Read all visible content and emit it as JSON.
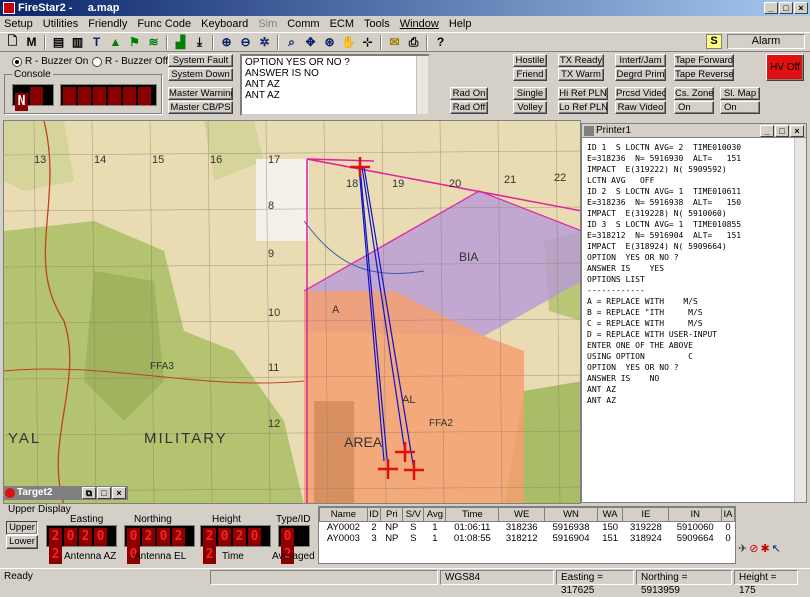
{
  "window": {
    "title": "FireStar2 -     a.map"
  },
  "menu": [
    "Setup",
    "Utilities",
    "Friendly",
    "Func Code",
    "Keyboard",
    "Sim",
    "Comm",
    "ECM",
    "Tools",
    "Window",
    "Help"
  ],
  "toolbar_icons": [
    "new-icon",
    "m-icon",
    "document-icon",
    "document-icon",
    "text-icon",
    "target-icon",
    "flag-icon",
    "grid-icon",
    "save-icon",
    "download-icon",
    "zoom-in-icon",
    "zoom-out-icon",
    "zoom-extents-icon",
    "search-icon",
    "pan-icon",
    "target-zoom-icon",
    "hand-icon",
    "pointer-icon",
    "comment-icon",
    "print-icon",
    "help-icon"
  ],
  "status_indicator": {
    "s_label": "S",
    "alarm": "Alarm"
  },
  "buzzer": {
    "on": "R - Buzzer On",
    "off": "R - Buzzer Off",
    "console": "Console"
  },
  "console_digits": "N",
  "system_buttons": [
    "System Fault",
    "System Down",
    "Master Warning",
    "Master CB/PS"
  ],
  "option_text": [
    "OPTION  YES OR NO ?",
    "ANSWER IS    NO",
    "ANT AZ",
    "ANT AZ"
  ],
  "ctrl_buttons": {
    "hostile": "Hostile",
    "friend": "Friend",
    "tx_ready": "TX Ready",
    "tx_warm": "TX Warm",
    "interf": "Interf/Jam",
    "degrd": "Degrd Prim",
    "tape_fwd": "Tape Forward",
    "tape_rev": "Tape Reverse",
    "hv_off": "HV Off",
    "rad_on": "Rad On",
    "rad_off": "Rad Off",
    "single": "Single",
    "volley": "Volley",
    "hi_ref": "Hi Ref PLN",
    "lo_ref": "Lo Ref PLN",
    "prcsd": "Prcsd Video",
    "raw": "Raw Video",
    "cs_zone": "Cs. Zone",
    "cs_on": "On",
    "sl_map": "Sl. Map",
    "sl_on": "On"
  },
  "map": {
    "labels": [
      "13",
      "14",
      "15",
      "16",
      "17",
      "18",
      "19",
      "20",
      "21",
      "22",
      "8",
      "9",
      "10",
      "11",
      "12",
      "FFA3",
      "MILITARY",
      "YAL",
      "BIA",
      "AREA",
      "FFA2",
      "AL",
      "A"
    ]
  },
  "printer": {
    "title": "Printer1",
    "lines": [
      "ID 1  S LOCTN AVG= 2  TIME010030",
      "E=318236  N= 5916930  ALT=   151",
      "IMPACT  E(319222) N( 5909592)",
      "LCTN AVG   OFF",
      "ID 2  S LOCTN AVG= 1  TIME010611",
      "E=318236  N= 5916938  ALT=   150",
      "IMPACT  E(319228) N( 5910060)",
      "ID 3  S LOCTN AVG= 1  TIME010855",
      "E=318212  N= 5916904  ALT=   151",
      "IMPACT  E(318924) N( 5909664)",
      "OPTION  YES OR NO ?",
      "ANSWER IS    YES",
      "OPTIONS LIST",
      "------------",
      "A = REPLACE WITH    M/S",
      "B = REPLACE \"ITH     M/S",
      "C = REPLACE WITH     M/S",
      "D = REPLACE WITH USER-INPUT",
      "ENTER ONE OF THE ABOVE",
      "USING OPTION         C",
      "OPTION  YES OR NO ?",
      "ANSWER IS    NO",
      "ANT AZ",
      "ANT AZ"
    ]
  },
  "target2": {
    "title": "Target2",
    "upper_display": "Upper Display",
    "upper": "Upper",
    "lower": "Lower",
    "easting_label": "Easting",
    "easting": "20202",
    "northing_label": "Northing",
    "northing": "02020",
    "height_label": "Height",
    "height": "20202",
    "type_label": "Type/ID",
    "type": "02",
    "antenna_az": "Antenna AZ",
    "antenna_el": "Antenna EL",
    "time": "Time",
    "averaged": "Averaged"
  },
  "table": {
    "headers": [
      "Name",
      "ID",
      "Pri",
      "S/V",
      "Avg",
      "Time",
      "WE",
      "WN",
      "WA",
      "IE",
      "IN",
      "IA"
    ],
    "rows": [
      [
        "AY0002",
        "2",
        "NP",
        "S",
        "1",
        "01:06:11",
        "318236",
        "5916938",
        "150",
        "319228",
        "5910060",
        "0"
      ],
      [
        "AY0003",
        "3",
        "NP",
        "S",
        "1",
        "01:08:55",
        "318212",
        "5916904",
        "151",
        "318924",
        "5909664",
        "0"
      ]
    ]
  },
  "status": {
    "ready": "Ready",
    "datum": "WGS84",
    "easting": "Easting = 317625",
    "northing": "Northing = 5913959",
    "height": "Height = 175"
  },
  "colors": {
    "title_start": "#0a246a",
    "led_red": "#ff2020",
    "hv_off_bg": "#e01010",
    "map_orange": "#f4a070",
    "map_purple": "#b89ad8",
    "map_green": "#b8c878"
  }
}
